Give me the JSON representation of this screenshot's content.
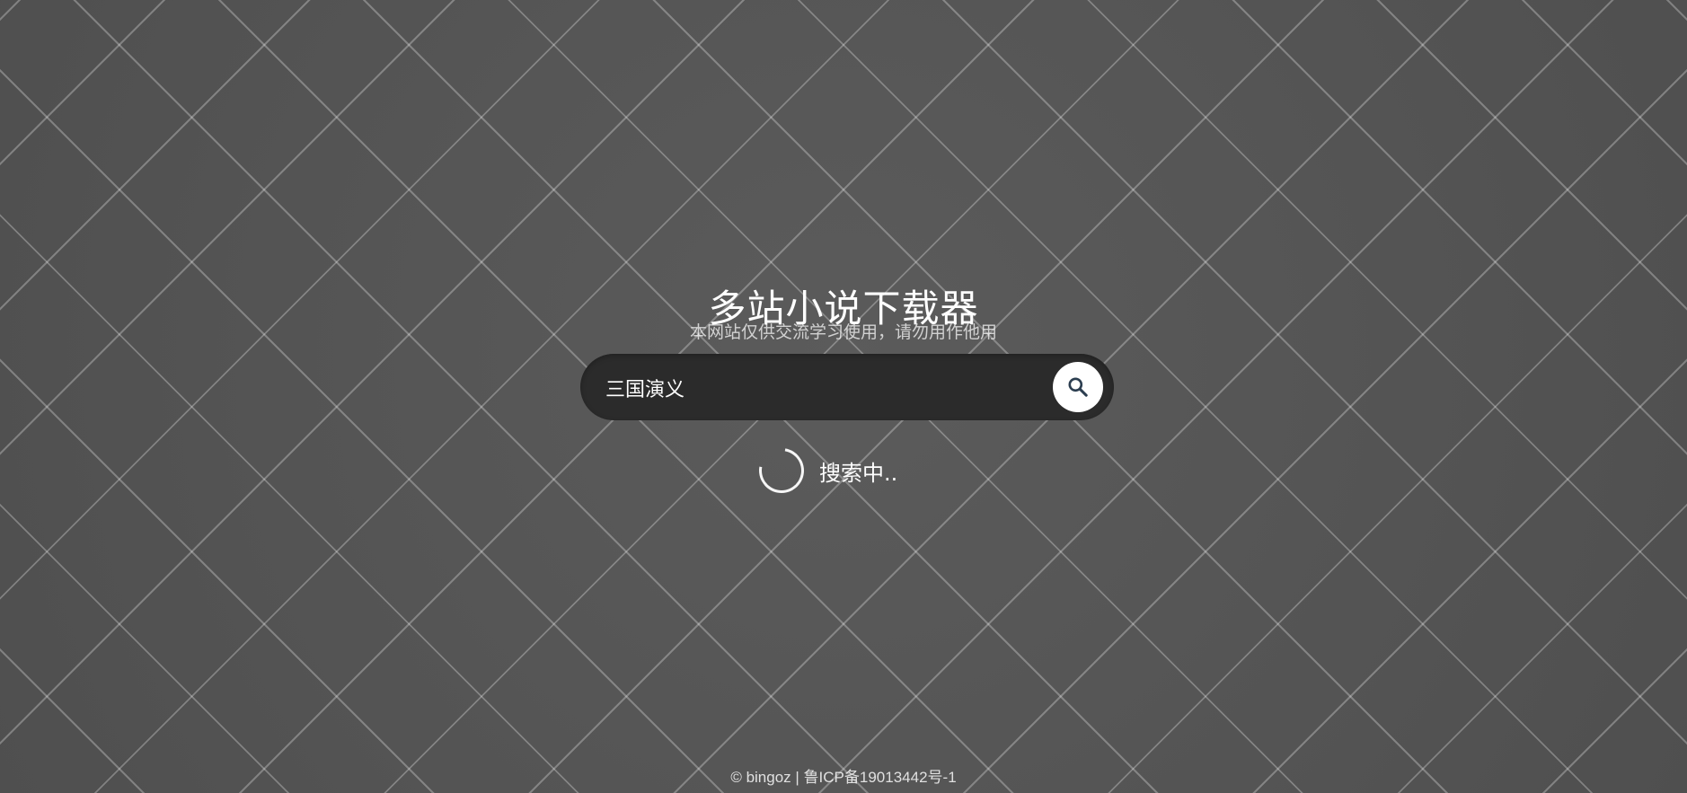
{
  "header": {
    "title": "多站小说下载器",
    "subtitle": "本网站仅供交流学习使用，请勿用作他用"
  },
  "search": {
    "value": "三国演义",
    "button_icon": "search-icon"
  },
  "status": {
    "text": "搜索中..",
    "icon": "loading-spinner-icon"
  },
  "footer": {
    "copyright": "© bingoz",
    "separator": " | ",
    "icp": "鲁ICP备19013442号-1"
  },
  "colors": {
    "background": "#555555",
    "search_bar": "#2b2b2b",
    "search_button": "#ffffff",
    "icon": "#2c3e50"
  }
}
